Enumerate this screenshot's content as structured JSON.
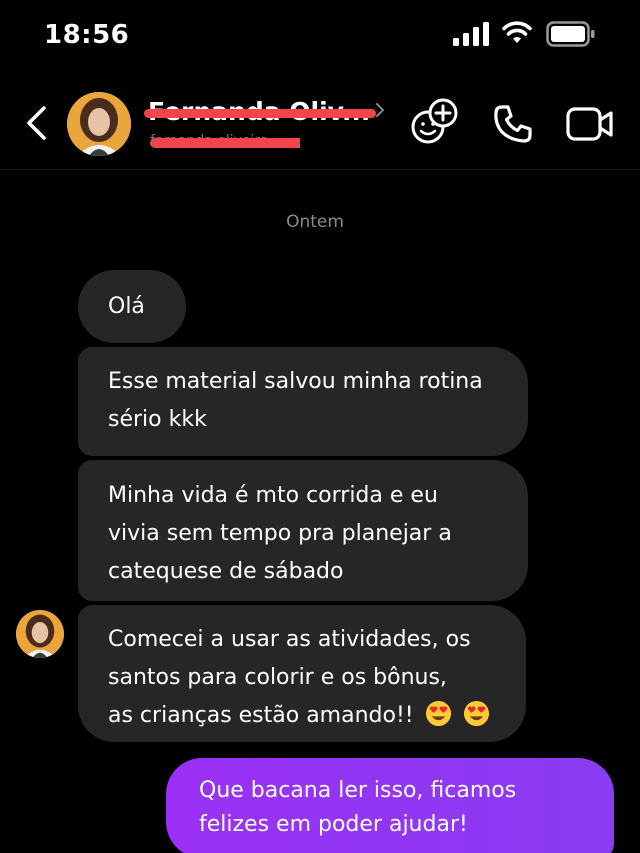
{
  "status": {
    "time": "18:56"
  },
  "header": {
    "name": "Fernanda Oliv...",
    "subtitle": "fernanda.oliveira"
  },
  "chat": {
    "date": "Ontem",
    "messages": [
      {
        "lines": [
          "Olá"
        ]
      },
      {
        "lines": [
          "Esse material salvou minha rotina",
          "sério kkk"
        ]
      },
      {
        "lines": [
          "Minha vida é mto corrida e eu",
          "vivia sem tempo pra planejar a",
          "catequese de sábado"
        ]
      },
      {
        "lines": [
          "Comecei a usar as atividades, os",
          "santos para colorir e os bônus,",
          "as crianças estão amando!!"
        ],
        "emoji": [
          "smiling-face-with-heart-eyes",
          "smiling-face-with-heart-eyes"
        ]
      }
    ],
    "outgoing": {
      "lines": [
        "Que bacana ler isso, ficamos",
        "felizes em poder ajudar!"
      ]
    }
  },
  "colors": {
    "background": "#000000",
    "incoming_bubble": "#262626",
    "outgoing_bubble": "#9a30f5",
    "redaction": "#f0464b"
  }
}
